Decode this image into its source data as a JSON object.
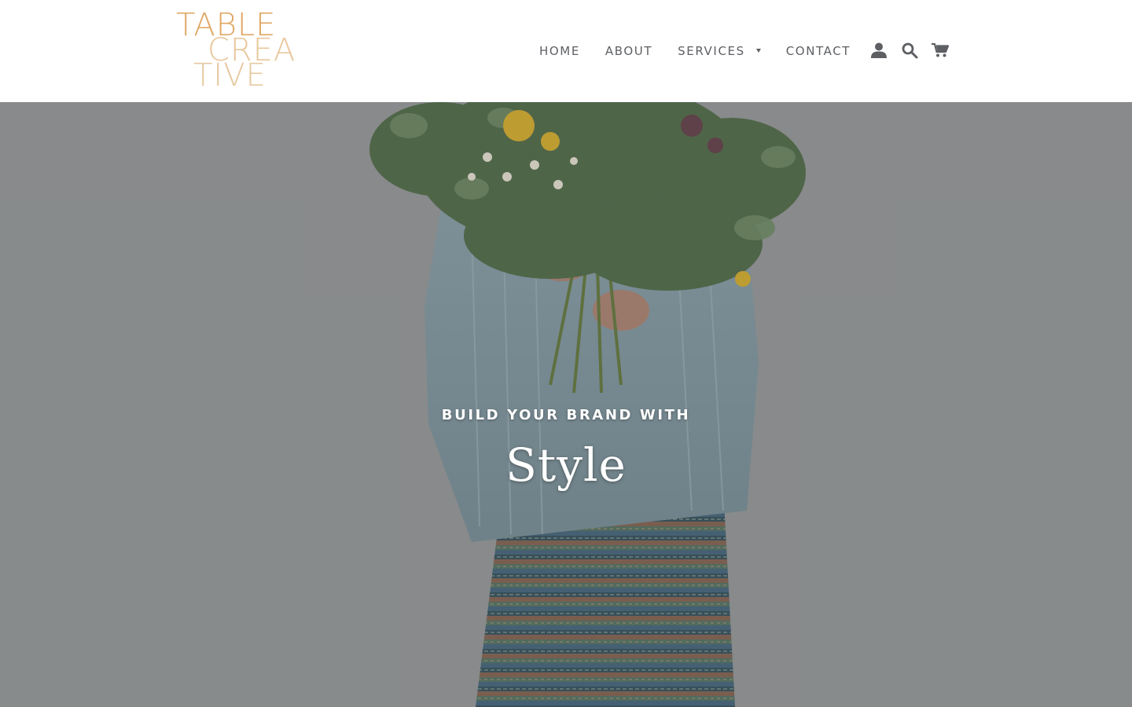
{
  "logo": {
    "line1": "TABLE",
    "line2": "CREA",
    "line3": "TIVE"
  },
  "nav": {
    "items": [
      {
        "label": "HOME"
      },
      {
        "label": "ABOUT"
      },
      {
        "label": "SERVICES",
        "has_dropdown": true
      },
      {
        "label": "CONTACT"
      }
    ]
  },
  "header_icons": [
    {
      "name": "account-icon"
    },
    {
      "name": "search-icon"
    },
    {
      "name": "cart-icon"
    }
  ],
  "hero": {
    "subtitle": "BUILD YOUR BRAND WITH",
    "title": "Style"
  },
  "colors": {
    "logo_primary": "#e0a865",
    "logo_secondary": "#e8c79c",
    "nav_text": "#5d5f63",
    "hero_bg": "#9a9d9e",
    "hero_text": "#ffffff"
  }
}
